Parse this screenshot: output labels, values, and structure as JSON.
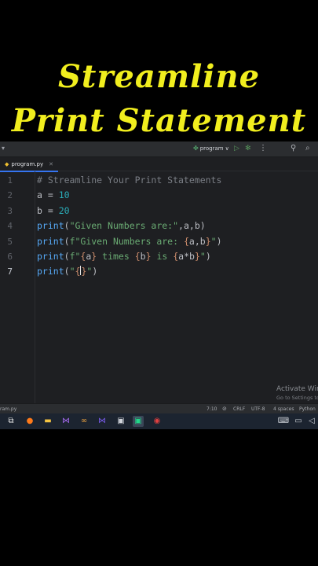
{
  "overlay": {
    "line1": "Streamline",
    "line2": "Print Statement",
    "color": "#f1ee1e"
  },
  "toolbar": {
    "run_config": "program",
    "run_config_chevron": "∨"
  },
  "editor": {
    "tab_label": "program.py",
    "line_numbers": [
      "1",
      "2",
      "3",
      "4",
      "5",
      "6",
      "7"
    ],
    "current_line": "7"
  },
  "watermark": {
    "line1": "Activate Win",
    "line2": "Go to Settings to"
  },
  "statusbar": {
    "left": "ram.py",
    "position": "7:10",
    "line_sep": "CRLF",
    "encoding": "UTF-8",
    "indent": "4 spaces",
    "interpreter": "Python"
  },
  "colors": {
    "editor_bg": "#1e1f22",
    "comment": "#7a7e85",
    "function": "#56a8f5",
    "string": "#6aab73",
    "number": "#2aacb8",
    "brace": "#cf8e6d"
  }
}
